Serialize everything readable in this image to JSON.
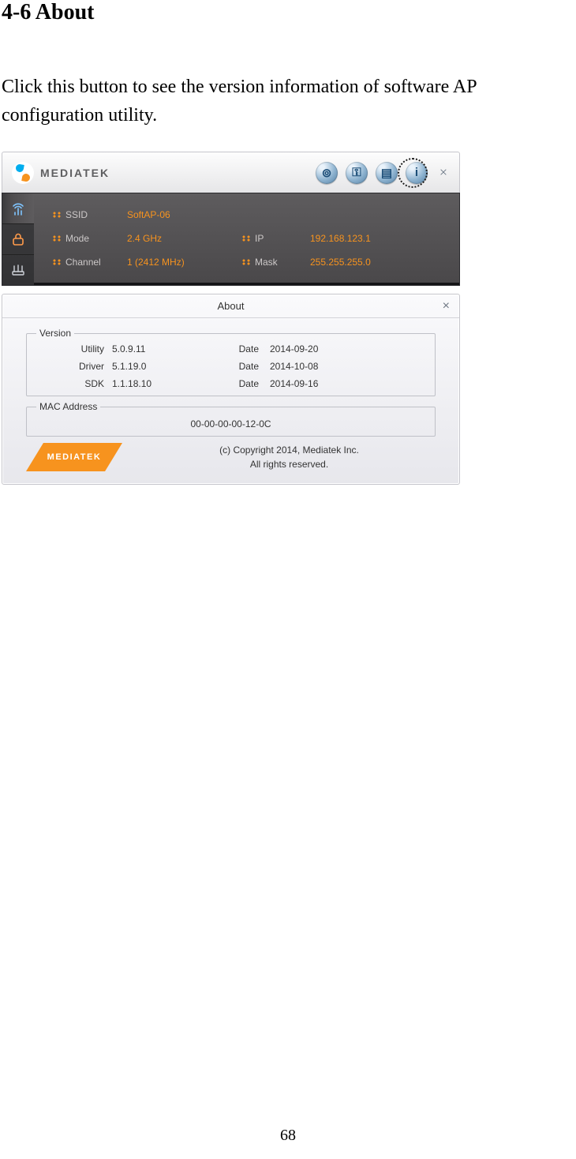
{
  "heading": "4-6 About",
  "body": "Click this button to see the version information of software AP configuration utility.",
  "page_number": "68",
  "brand": "MEDIATEK",
  "ap_panel": {
    "icons": {
      "wireless": "⊚",
      "security": "⚿",
      "list": "▤",
      "info": "i"
    },
    "close": "×",
    "ssid_label": "SSID",
    "ssid_value": "SoftAP-06",
    "mode_label": "Mode",
    "mode_value": "2.4 GHz",
    "ip_label": "IP",
    "ip_value": "192.168.123.1",
    "channel_label": "Channel",
    "channel_value": "1 (2412 MHz)",
    "mask_label": "Mask",
    "mask_value": "255.255.255.0"
  },
  "about": {
    "title": "About",
    "close": "×",
    "version_legend": "Version",
    "utility_label": "Utility",
    "utility_value": "5.0.9.11",
    "utility_date_label": "Date",
    "utility_date_value": "2014-09-20",
    "driver_label": "Driver",
    "driver_value": "5.1.19.0",
    "driver_date_label": "Date",
    "driver_date_value": "2014-10-08",
    "sdk_label": "SDK",
    "sdk_value": "1.1.18.10",
    "sdk_date_label": "Date",
    "sdk_date_value": "2014-09-16",
    "mac_legend": "MAC Address",
    "mac_value": "00-00-00-00-12-0C",
    "badge": "MEDIATEK",
    "copyright_line1": "(c) Copyright 2014, Mediatek Inc.",
    "copyright_line2": "All rights reserved."
  }
}
